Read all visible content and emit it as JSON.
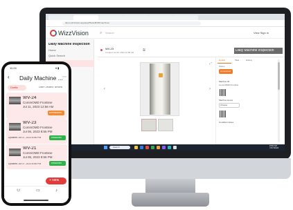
{
  "browser": {
    "tabs": [
      "Windows",
      "WizMachine",
      "QuickF",
      "Work Tools",
      "Inspections Overview",
      "New Tab"
    ],
    "url": "demo.wizzvision.app/app/65e2e8f1b5/machines"
  },
  "app": {
    "logo": "WizzVision",
    "search_placeholder": "Search",
    "view_controls": "View  Sign in"
  },
  "left_panel": {
    "title": "Daily Machine Inspection",
    "home": "Home",
    "search": "Quick Search"
  },
  "detail": {
    "record_id": "WV-23",
    "subtitle": "Created Jul 05, 2023 10:58 AM",
    "badge": "Daily Machine Inspection",
    "nav_prev": "‹",
    "nav_next": "›",
    "expand": "⤢"
  },
  "right_panel": {
    "tabs": [
      "Details",
      "Task",
      "History"
    ],
    "status_label": "Status",
    "status_value": "Unresolved",
    "machine_label": "Machine ID",
    "machine_value": "CommOMD Frontline",
    "mh_label": "Machine Hours",
    "mh_value": "Choose",
    "condition_label": "Condition Notes"
  },
  "taskbar": {
    "search": "Search",
    "clock": "8:58 AM\n7/27/2023"
  },
  "phone": {
    "time": "11:24",
    "status_right": "▾ ▮",
    "title": "Daily Machine ...",
    "more": "⋯",
    "draft_filter": "Drafts",
    "sort": "Date Created: Newest",
    "cards": [
      {
        "id": "WV-24",
        "place": "CommOMD Frontline",
        "date": "Jul 11, 2023 12:56 AM",
        "updated": "",
        "button": "Unresolved",
        "button_color": "orange"
      },
      {
        "id": "WV-23",
        "place": "CommOMD Frontline",
        "date": "Jul 06, 2023 8:56 PM",
        "updated": "Updated Jul 07, 2023 6:56 PM",
        "button": "Resolved",
        "button_color": "green"
      },
      {
        "id": "WV-21",
        "place": "CommOMD Frontline",
        "date": "Jul 06, 2023 8:56 PM",
        "updated": "Updated Jul 07, 2023 6:56 PM",
        "button": "Resolved",
        "button_color": "green"
      }
    ],
    "new_button": "+ New",
    "bottom_icons": [
      "user-icon",
      "inbox-icon",
      "bell-icon"
    ]
  },
  "colors": {
    "accent": "#e23b3b",
    "orange": "#f28a30",
    "green": "#2fb24a"
  }
}
